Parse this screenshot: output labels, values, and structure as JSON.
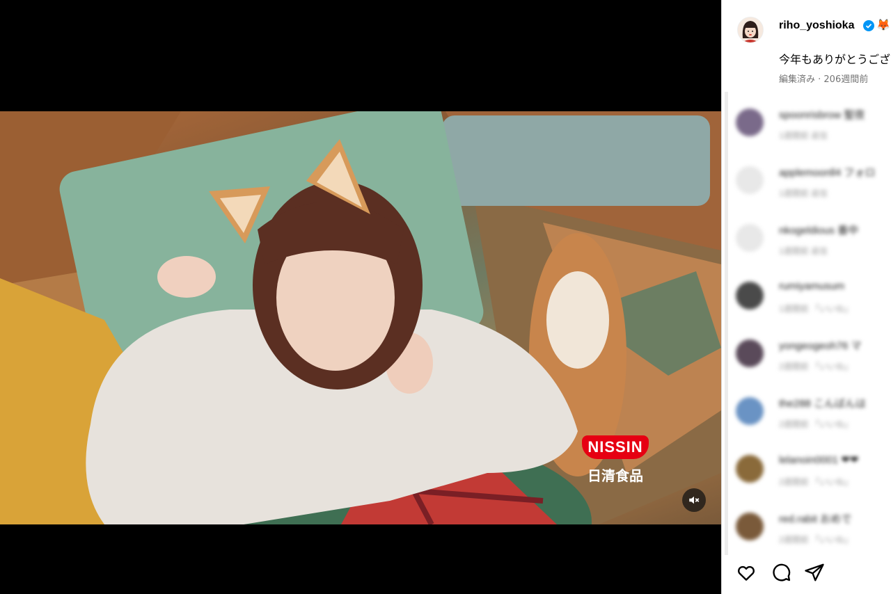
{
  "post": {
    "username": "riho_yoshioka",
    "emoji": "🦊",
    "caption": "今年もありがとうござ",
    "meta": "編集済み · 206週間前"
  },
  "video": {
    "brand_name": "NISSIN",
    "brand_sub": "日清食品",
    "muted": true
  },
  "comments": [
    {
      "user": "spoonrisbrow 聖夜",
      "sub": "1週間前   返信",
      "avatar_color": "#7a6a8a"
    },
    {
      "user": "applemoonll4 フォロ",
      "sub": "1週間前   返信",
      "avatar_color": "#e3e3e3"
    },
    {
      "user": "nkogeldious 番中",
      "sub": "1週間前   返信",
      "avatar_color": "#e3e3e3"
    },
    {
      "user": "rumiyamusum",
      "sub": "1週間前   「いいね」",
      "avatar_color": "#4a4a4a"
    },
    {
      "user": "yongeogeoh76 マ",
      "sub": "2週間前   「いいね」",
      "avatar_color": "#5a4a5a"
    },
    {
      "user": "the288 こんばんは",
      "sub": "2週間前   「いいね」",
      "avatar_color": "#6a93c4"
    },
    {
      "user": "lelanoin0001 ❤❤",
      "sub": "2週間前   「いいね」",
      "avatar_color": "#8a6a3a"
    },
    {
      "user": "red.rabit おめで",
      "sub": "2週間前   「いいね」",
      "avatar_color": "#7a5a3a"
    }
  ],
  "icons": {
    "like": "heart-icon",
    "comment": "comment-icon",
    "share": "share-icon",
    "mute": "speaker-muted-icon",
    "verified": "verified-badge-icon"
  },
  "colors": {
    "brand_red": "#e60012",
    "verified_blue": "#0095f6",
    "meta_gray": "#737373"
  }
}
